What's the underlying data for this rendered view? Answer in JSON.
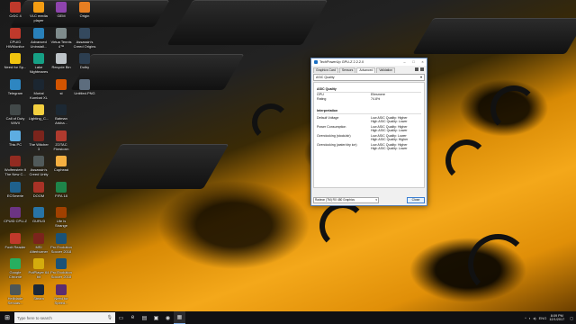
{
  "desktop_icons": [
    {
      "label": "CrDC 4",
      "color": "#c0392b",
      "icon": "app-icon"
    },
    {
      "label": "VLC media\nplayer",
      "color": "#f39c12",
      "icon": "vlc-icon"
    },
    {
      "label": "GEM",
      "color": "#8e44ad",
      "icon": "app-icon"
    },
    {
      "label": "Origin",
      "color": "#e67e22",
      "icon": "origin-icon"
    },
    {
      "label": "CPUID\nHWMonitor",
      "color": "#c0392b",
      "icon": "hwmonitor-icon"
    },
    {
      "label": "Advanced\nUninstall...",
      "color": "#2980b9",
      "icon": "app-icon"
    },
    {
      "label": "Virtua Tennis\n4™",
      "color": "#7f8c8d",
      "icon": "game-icon"
    },
    {
      "label": "Assassin's\nCreed Origins",
      "color": "#34495e",
      "icon": "game-icon"
    },
    {
      "label": "Need for Sp...",
      "color": "#f1c40f",
      "icon": "folder-icon"
    },
    {
      "label": "Lake\nNightmares",
      "color": "#16a085",
      "icon": "game-icon"
    },
    {
      "label": "Recycle Bin",
      "color": "#bdc3c7",
      "icon": "recycle-bin-icon"
    },
    {
      "label": "Dolby",
      "color": "#2c3e50",
      "icon": "dolby-icon"
    },
    {
      "label": "Telegram",
      "color": "#2e86c1",
      "icon": "telegram-icon"
    },
    {
      "label": "Mortal\nKombat XL",
      "color": "#1b2631",
      "icon": "game-icon"
    },
    {
      "label": "st",
      "color": "#d35400",
      "icon": "file-icon"
    },
    {
      "label": "Untitled.PNG",
      "color": "#5d6d7e",
      "icon": "image-file-icon"
    },
    {
      "label": "Call of Duty\nWWII",
      "color": "#424949",
      "icon": "game-icon"
    },
    {
      "label": "Lighting_C...",
      "color": "#f4d03f",
      "icon": "folder-icon"
    },
    {
      "label": "Batman\nArkha...",
      "color": "#1c2833",
      "icon": "game-icon"
    },
    {
      "label": "",
      "color": "transparent",
      "icon": ""
    },
    {
      "label": "This PC",
      "color": "#5dade2",
      "icon": "this-pc-icon"
    },
    {
      "label": "The Witcher\n3",
      "color": "#7b241c",
      "icon": "game-icon"
    },
    {
      "label": "ZOTAC\nFirestorm",
      "color": "#b03a2e",
      "icon": "app-icon"
    },
    {
      "label": "",
      "color": "transparent",
      "icon": ""
    },
    {
      "label": "Wolfenstein II\nThe New C...",
      "color": "#922b21",
      "icon": "game-icon"
    },
    {
      "label": "Assassin's\nCreed Unity",
      "color": "#515a5a",
      "icon": "game-icon"
    },
    {
      "label": "Cuphead",
      "color": "#f5b041",
      "icon": "game-icon"
    },
    {
      "label": "",
      "color": "transparent",
      "icon": ""
    },
    {
      "label": "ECSmerie",
      "color": "#1f618d",
      "icon": "app-icon"
    },
    {
      "label": "DOOM",
      "color": "#a93226",
      "icon": "game-icon"
    },
    {
      "label": "FIFA 18",
      "color": "#1e8449",
      "icon": "game-icon"
    },
    {
      "label": "",
      "color": "transparent",
      "icon": ""
    },
    {
      "label": "CPUID CPU-Z",
      "color": "#6c3483",
      "icon": "cpuz-icon"
    },
    {
      "label": "GURU3",
      "color": "#2874a6",
      "icon": "app-icon"
    },
    {
      "label": "Life is\nStrange",
      "color": "#a04000",
      "icon": "game-icon"
    },
    {
      "label": "",
      "color": "transparent",
      "icon": ""
    },
    {
      "label": "Foxit Reader",
      "color": "#c0392b",
      "icon": "foxit-icon"
    },
    {
      "label": "MSI\nAfterburner",
      "color": "#7b241c",
      "icon": "afterburner-icon"
    },
    {
      "label": "Pro Evolution\nSoccer 2018",
      "color": "#1a5276",
      "icon": "game-icon"
    },
    {
      "label": "",
      "color": "transparent",
      "icon": ""
    },
    {
      "label": "Google\nChrome",
      "color": "#27ae60",
      "icon": "chrome-icon"
    },
    {
      "label": "PotPlayer 64\nbit",
      "color": "#d4ac0d",
      "icon": "potplayer-icon"
    },
    {
      "label": "Pro Evolution\nSoccer 2018",
      "color": "#1a5276",
      "icon": "game-icon"
    },
    {
      "label": "",
      "color": "transparent",
      "icon": ""
    },
    {
      "label": "Hellblade\nSenuas...",
      "color": "#4d5656",
      "icon": "game-icon"
    },
    {
      "label": "Steam",
      "color": "#1b2838",
      "icon": "steam-icon"
    },
    {
      "label": "Need for\nSpeed...",
      "color": "#5b2c6f",
      "icon": "game-icon"
    },
    {
      "label": "",
      "color": "transparent",
      "icon": ""
    }
  ],
  "window": {
    "title": "TechPowerUp GPU-Z 2.2.2.0",
    "minimize": "–",
    "maximize": "□",
    "close": "×",
    "tabs": [
      "Graphics Card",
      "Sensors",
      "Advanced",
      "Validation"
    ],
    "active_tab": 2,
    "category": "ASIC Quality",
    "sections": [
      {
        "title": "ASIC Quality",
        "rows": [
          {
            "k": "GPU",
            "v": "Ellesmere"
          },
          {
            "k": "Rating",
            "v": "74.8%"
          }
        ]
      }
    ],
    "interpretation": {
      "title": "Interpretation",
      "rows": [
        {
          "k": "Default Voltage",
          "v": "Low ASIC Quality: Higher\nHigh ASIC Quality: Lower"
        },
        {
          "k": "Power Consumption",
          "v": "Low ASIC Quality: Higher\nHigh ASIC Quality: Lower"
        },
        {
          "k": "Overclocking (stock/air)",
          "v": "Low ASIC Quality: Lower\nHigh ASIC Quality: Higher"
        },
        {
          "k": "Overclocking (water/dry ice)",
          "v": "Low ASIC Quality: Higher\nHigh ASIC Quality: Lower"
        }
      ]
    },
    "gpu_select": "Radeon (TM) RX 480 Graphics",
    "close_button": "Close"
  },
  "taskbar": {
    "search_placeholder": "Type here to search",
    "clock_time": "8:09 PM",
    "clock_date": "12/1/2017",
    "language": "ENG"
  }
}
